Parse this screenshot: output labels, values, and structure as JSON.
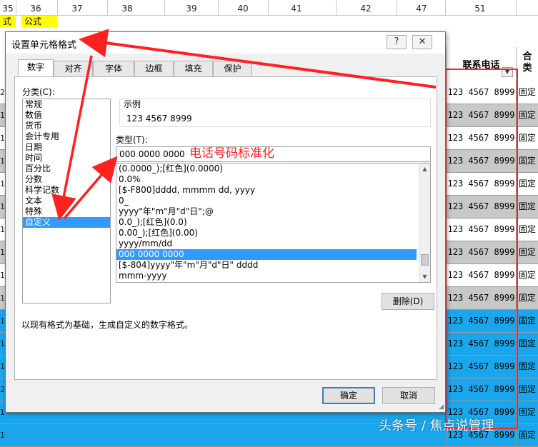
{
  "sheet": {
    "col_numbers": [
      "35",
      "36",
      "37",
      "38",
      "39",
      "40",
      "41",
      "42",
      "47",
      "51"
    ],
    "yellow_labels": [
      "式",
      "公式"
    ],
    "header_phone": "联系电话",
    "header_right_top": "合",
    "header_right_bottom": "类",
    "left_chars": [
      "2",
      "1",
      "1",
      "1",
      "1",
      "1",
      "1",
      "1",
      "1",
      "1",
      "1",
      "1",
      "1",
      "2",
      "1",
      "1"
    ],
    "phone_value": "123 4567 8999",
    "right_value": "固定",
    "row_colors": [
      "white",
      "gray",
      "white",
      "gray",
      "white",
      "gray",
      "white",
      "gray",
      "white",
      "gray",
      "blue",
      "blue",
      "blue",
      "blue",
      "blue",
      "blue"
    ],
    "red_highlight": "#ff2020"
  },
  "dialog": {
    "title": "设置单元格格式",
    "help_button": "?",
    "close_button": "✕",
    "tabs": [
      "数字",
      "对齐",
      "字体",
      "边框",
      "填充",
      "保护"
    ],
    "active_tab": "数字",
    "category_label": "分类(C):",
    "categories": [
      "常规",
      "数值",
      "货币",
      "会计专用",
      "日期",
      "时间",
      "百分比",
      "分数",
      "科学记数",
      "文本",
      "特殊",
      "自定义"
    ],
    "selected_category": "自定义",
    "sample_label": "示例",
    "sample_value": "123 4567 8999",
    "type_label": "类型(T):",
    "type_input_value": "000 0000 0000",
    "formats": [
      "(0.0000_);[红色](0.0000)",
      "0.0%",
      "[$-F800]dddd, mmmm dd, yyyy",
      "0_",
      "yyyy\"年\"m\"月\"d\"日\";@",
      "0.0_);[红色](0.0)",
      "0.00_);[红色](0.00)",
      "yyyy/mm/dd",
      "000 0000 0000",
      "[$-804]yyyy\"年\"m\"月\"d\"日\" dddd",
      "mmm-yyyy"
    ],
    "selected_format": "000 0000 0000",
    "delete_button": "删除(D)",
    "description": "以现有格式为基础，生成自定义的数字格式。",
    "ok_button": "确定",
    "cancel_button": "取消"
  },
  "annotation": {
    "text": "电话号码标准化",
    "color": "#ff2020"
  },
  "watermark": "头条号 / 焦点说管理"
}
